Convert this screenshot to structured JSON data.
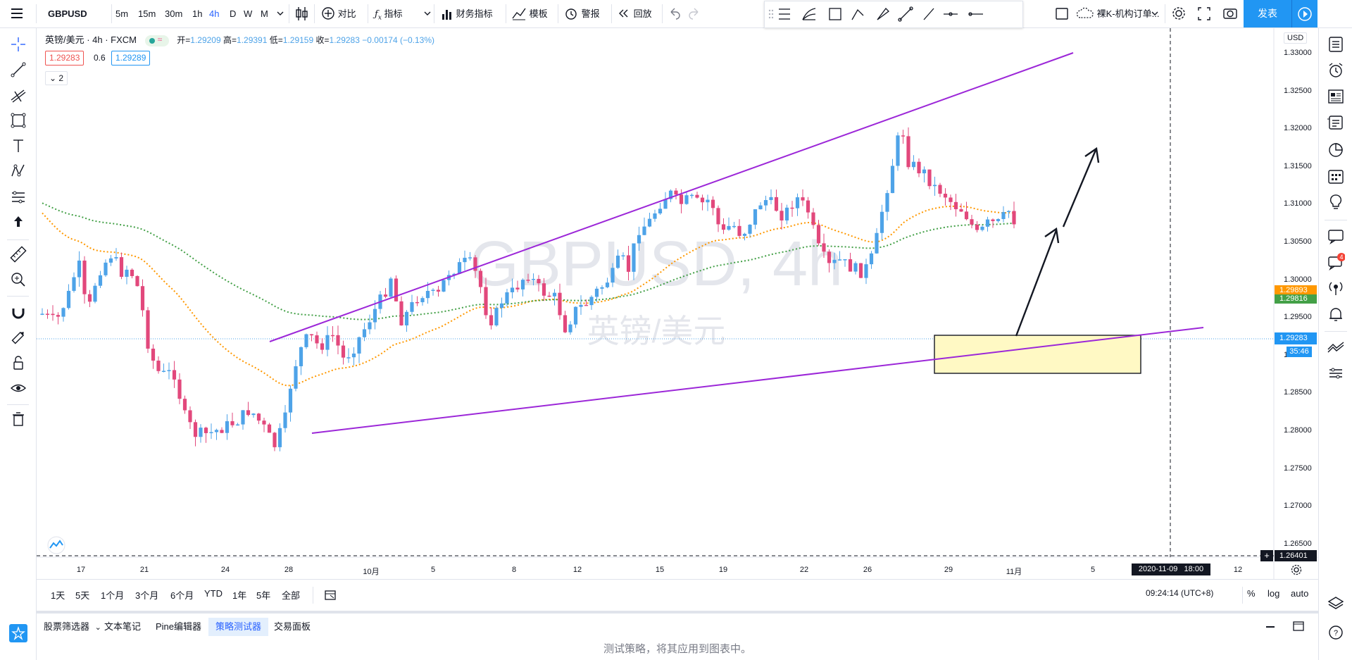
{
  "header": {
    "symbol": "GBPUSD",
    "timeframes": [
      "5m",
      "15m",
      "30m",
      "1h",
      "4h",
      "D",
      "W",
      "M"
    ],
    "active_timeframe": "4h",
    "compare_label": "对比",
    "indicators_label": "指标",
    "financials_label": "财务指标",
    "template_label": "模板",
    "alert_label": "警报",
    "replay_label": "回放",
    "layout_name": "裸K-机构订单...",
    "publish_label": "发表"
  },
  "legend": {
    "title": "英镑/美元 · 4h · FXCM",
    "open_label": "开=",
    "open": "1.29209",
    "high_label": "高=",
    "high": "1.29391",
    "low_label": "低=",
    "low": "1.29159",
    "close_label": "收=",
    "close": "1.29283",
    "change": "−0.00174 (−0.13%)",
    "bid": "1.29283",
    "spread": "0.6",
    "ask": "1.29289",
    "indicator_count": "2"
  },
  "watermark": {
    "symbol": "GBPUSD, 4h",
    "name": "英镑/美元"
  },
  "price_axis": {
    "currency": "USD",
    "ticks": [
      "1.33000",
      "1.32500",
      "1.32000",
      "1.31500",
      "1.31000",
      "1.30500",
      "1.30000",
      "1.29500",
      "1.29000",
      "1.28500",
      "1.28000",
      "1.27500",
      "1.27000",
      "1.26500"
    ],
    "ema_orange_label": "1.29893",
    "ema_green_label": "1.29816",
    "last_price": "1.29283",
    "countdown": "35:46",
    "crosshair_price": "1.26401"
  },
  "time_axis": {
    "ticks": [
      "17",
      "21",
      "24",
      "28",
      "10月",
      "5",
      "8",
      "12",
      "15",
      "19",
      "22",
      "26",
      "29",
      "11月",
      "5",
      "12"
    ],
    "crosshair_time": "2020-11-09   18:00"
  },
  "range_bar": {
    "ranges": [
      "1天",
      "5天",
      "1个月",
      "3个月",
      "6个月",
      "YTD",
      "1年",
      "5年",
      "全部"
    ],
    "clock": "09:24:14 (UTC+8)",
    "percent": "%",
    "log": "log",
    "auto": "auto"
  },
  "bottom_tabs": {
    "tabs": [
      "股票筛选器",
      "文本笔记",
      "Pine编辑器",
      "策略测试器",
      "交易面板"
    ],
    "active": "策略测试器",
    "message": "测试策略，将其应用到图表中。"
  },
  "colors": {
    "bull": "#4ea3e8",
    "bear": "#e2487c",
    "trendline": "#9c27d8",
    "ema_orange": "#ff9800",
    "ema_green": "#43a047",
    "zone_fill": "#fff9c4",
    "accent": "#2962ff"
  },
  "icons": [
    "menu-icon",
    "candles-icon",
    "compare-icon",
    "indicator-icon",
    "financials-icon",
    "template-icon",
    "alert-icon",
    "replay-icon",
    "undo-icon",
    "redo-icon",
    "settings-icon",
    "fullscreen-icon",
    "camera-icon",
    "play-icon",
    "cross-icon",
    "trendline-icon",
    "fib-icon",
    "rectangle-icon",
    "text-icon",
    "pattern-icon",
    "forecast-icon",
    "arrow-up-icon",
    "ruler-icon",
    "zoom-icon",
    "magnet-icon",
    "lock-icon",
    "eye-icon",
    "trash-icon",
    "watchlist-icon",
    "alarm-icon",
    "news-icon",
    "datawindow-icon",
    "hotlist-icon",
    "calendar-icon",
    "ideas-icon",
    "chat-icon",
    "notifications-icon",
    "broadcast-icon",
    "bell-icon",
    "order-panel-icon",
    "layers-icon"
  ]
}
